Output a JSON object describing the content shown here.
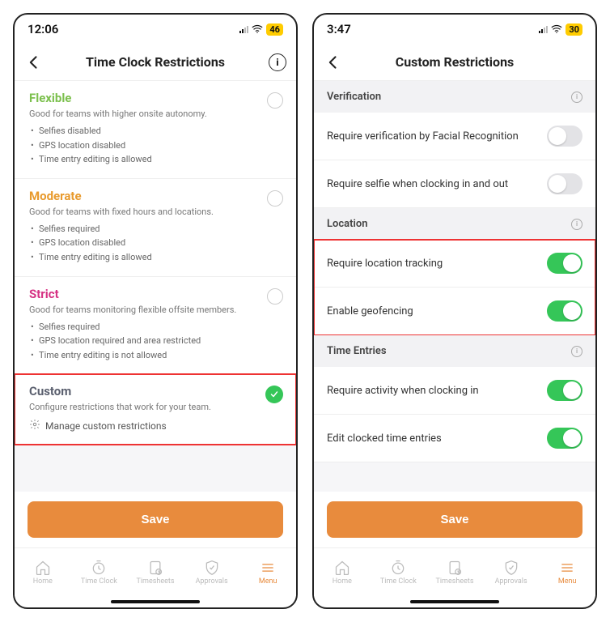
{
  "left": {
    "status": {
      "time": "12:06",
      "battery": "46"
    },
    "header": {
      "title": "Time Clock Restrictions"
    },
    "options": {
      "flexible": {
        "title": "Flexible",
        "desc": "Good for teams with higher onsite autonomy.",
        "bullets": [
          "Selfies disabled",
          "GPS location disabled",
          "Time entry editing is allowed"
        ]
      },
      "moderate": {
        "title": "Moderate",
        "desc": "Good for teams with fixed hours and locations.",
        "bullets": [
          "Selfies required",
          "GPS location disabled",
          "Time entry editing is allowed"
        ]
      },
      "strict": {
        "title": "Strict",
        "desc": "Good for teams monitoring flexible offsite members.",
        "bullets": [
          "Selfies required",
          "GPS location required and area restricted",
          "Time entry editing is not allowed"
        ]
      },
      "custom": {
        "title": "Custom",
        "desc": "Configure restrictions that work for your team.",
        "manage": "Manage custom restrictions"
      }
    },
    "save": "Save"
  },
  "right": {
    "status": {
      "time": "3:47",
      "battery": "30"
    },
    "header": {
      "title": "Custom Restrictions"
    },
    "sections": {
      "verification": {
        "title": "Verification"
      },
      "location": {
        "title": "Location"
      },
      "timeentries": {
        "title": "Time Entries"
      }
    },
    "rows": {
      "facial": "Require verification by Facial Recognition",
      "selfie": "Require selfie when clocking in and out",
      "loctrack": "Require location tracking",
      "geofence": "Enable geofencing",
      "activity": "Require activity when clocking in",
      "editentries": "Edit clocked time entries"
    },
    "save": "Save"
  },
  "tabs": {
    "home": "Home",
    "timeclock": "Time Clock",
    "timesheets": "Timesheets",
    "approvals": "Approvals",
    "menu": "Menu"
  }
}
